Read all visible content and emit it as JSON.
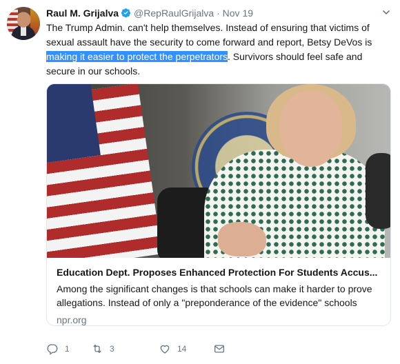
{
  "tweet": {
    "author_name": "Raul M. Grijalva",
    "handle": "@RepRaulGrijalva",
    "separator": "·",
    "date": "Nov 19",
    "text_before": "The Trump Admin. can't help themselves. Instead of ensuring that victims of sexual assault have the security to come forward and report, Betsy DeVos is ",
    "text_highlight": "making it easier to protect the perpetrators",
    "text_after": ". Survivors should feel safe and secure in our schools."
  },
  "card": {
    "title": "Education Dept. Proposes Enhanced Protection For Students Accus...",
    "description": "Among the significant changes is that schools can make it harder to prove allegations. Instead of only a \"preponderance of the evidence\" schools could",
    "domain": "npr.org"
  },
  "actions": {
    "reply_count": "1",
    "retweet_count": "3",
    "like_count": "14"
  },
  "icons": {
    "verified": "verified-badge-icon",
    "caret": "chevron-down-icon",
    "reply": "reply-icon",
    "retweet": "retweet-icon",
    "like": "heart-icon",
    "dm": "envelope-icon"
  },
  "colors": {
    "text": "#14171a",
    "muted": "#657786",
    "verified": "#1da1f2",
    "selection": "#3390ff",
    "border": "#e1e8ed"
  }
}
